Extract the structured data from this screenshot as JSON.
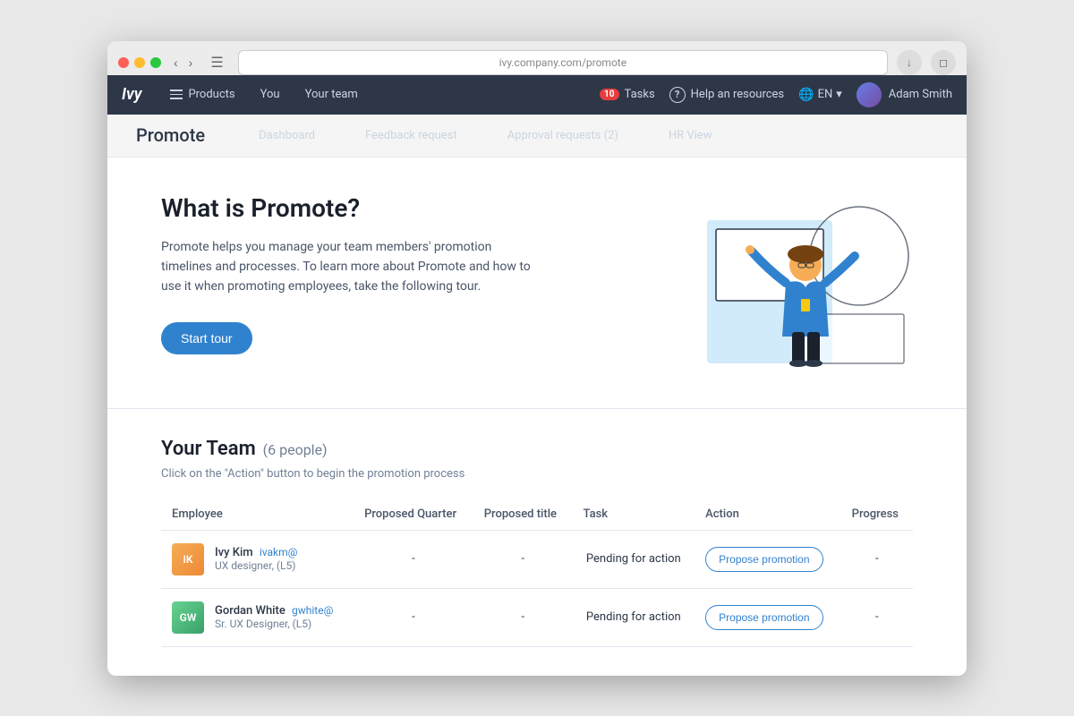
{
  "browser": {
    "url_placeholder": "ivy.company.com/promote"
  },
  "app": {
    "logo": "Ivy",
    "nav_items": [
      {
        "label": "Products",
        "id": "products",
        "has_icon": true
      },
      {
        "label": "You",
        "id": "you"
      },
      {
        "label": "Your team",
        "id": "your-team"
      }
    ],
    "tasks": {
      "label": "Tasks",
      "count": "10"
    },
    "help": {
      "label": "Help an resources"
    },
    "lang": {
      "code": "EN"
    },
    "user": {
      "name": "Adam Smith"
    }
  },
  "sub_nav": {
    "app_name": "Promote",
    "items": [
      {
        "label": "Dashboard",
        "id": "dashboard"
      },
      {
        "label": "Feedback request",
        "id": "feedback"
      },
      {
        "label": "Approval requests (2)",
        "id": "approval"
      },
      {
        "label": "HR View",
        "id": "hr-view"
      }
    ]
  },
  "hero": {
    "title": "What is Promote?",
    "description": "Promote helps you manage your team members' promotion timelines and processes. To learn more about Promote and how to use it when promoting employees, take the following tour.",
    "cta_label": "Start tour"
  },
  "team": {
    "title": "Your Team",
    "count_label": "(6 people)",
    "subtitle": "Click on the \"Action\" button to begin the promotion process",
    "columns": [
      {
        "label": "Employee"
      },
      {
        "label": "Proposed Quarter"
      },
      {
        "label": "Proposed title"
      },
      {
        "label": "Task"
      },
      {
        "label": "Action"
      },
      {
        "label": "Progress"
      }
    ],
    "rows": [
      {
        "name": "Ivy Kim",
        "email": "ivakm@",
        "role": "UX designer, (L5)",
        "proposed_quarter": "-",
        "proposed_title": "-",
        "task": "Pending for action",
        "action_label": "Propose promotion",
        "progress": "-",
        "avatar_initials": "IK"
      },
      {
        "name": "Gordan White",
        "email": "gwhite@",
        "role": "Sr. UX Designer, (L5)",
        "proposed_quarter": "-",
        "proposed_title": "-",
        "task": "Pending for action",
        "action_label": "Propose promotion",
        "progress": "-",
        "avatar_initials": "GW"
      }
    ]
  }
}
